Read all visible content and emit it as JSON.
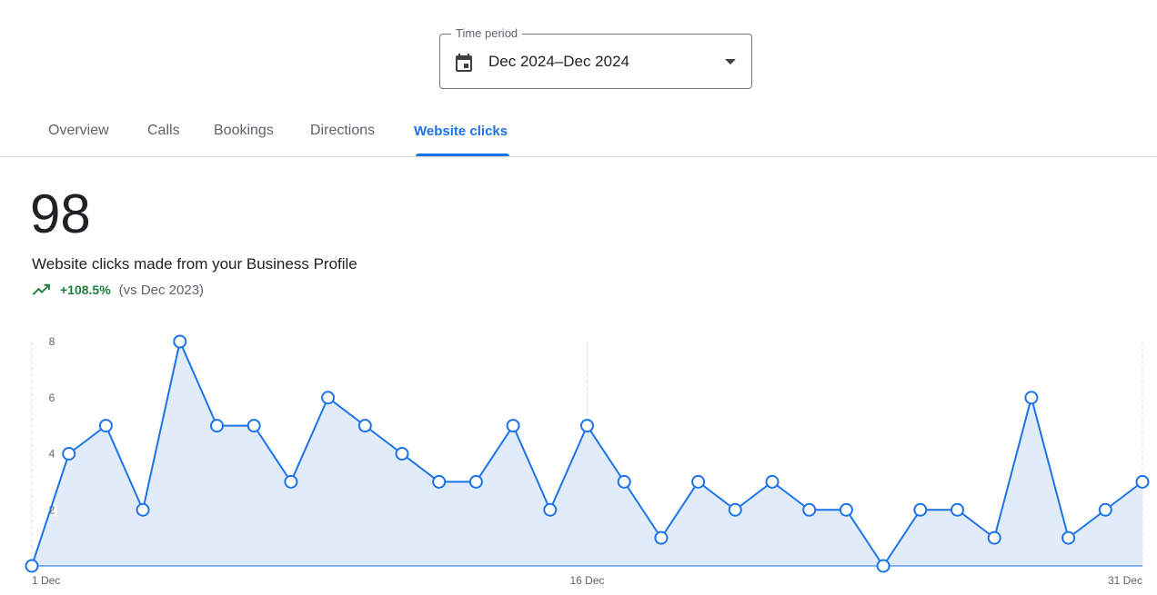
{
  "period_select": {
    "label": "Time period",
    "value": "Dec 2024–Dec 2024",
    "icon": "calendar-icon"
  },
  "tabs": [
    {
      "label": "Overview",
      "active": false
    },
    {
      "label": "Calls",
      "active": false
    },
    {
      "label": "Bookings",
      "active": false
    },
    {
      "label": "Directions",
      "active": false
    },
    {
      "label": "Website clicks",
      "active": true
    }
  ],
  "metric": {
    "value": "98",
    "description": "Website clicks made from your Business Profile",
    "change": "+108.5%",
    "comparison": "(vs Dec 2023)",
    "trend_icon": "trending-up-icon"
  },
  "colors": {
    "accent": "#1a73e8",
    "positive": "#188038",
    "area_fill": "#e1ebfa"
  },
  "chart_data": {
    "type": "area",
    "x": [
      1,
      2,
      3,
      4,
      5,
      6,
      7,
      8,
      9,
      10,
      11,
      12,
      13,
      14,
      15,
      16,
      17,
      18,
      19,
      20,
      21,
      22,
      23,
      24,
      25,
      26,
      27,
      28,
      29,
      30,
      31
    ],
    "x_tick_values": [
      1,
      16,
      31
    ],
    "x_tick_labels": [
      "1 Dec",
      "16 Dec",
      "31 Dec"
    ],
    "y_ticks": [
      2,
      4,
      6,
      8
    ],
    "series": [
      {
        "values": [
          0,
          4,
          5,
          2,
          8,
          5,
          5,
          3,
          6,
          5,
          4,
          3,
          3,
          5,
          2,
          5,
          3,
          1,
          3,
          2,
          3,
          2,
          2,
          0,
          2,
          2,
          1,
          6,
          1,
          2,
          3
        ]
      }
    ],
    "ylim": [
      0,
      8
    ],
    "grid": "vertical-dashed"
  }
}
